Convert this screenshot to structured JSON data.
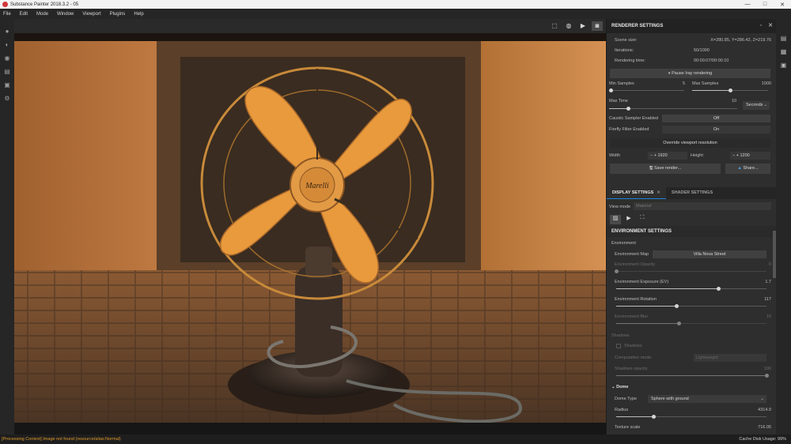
{
  "app": {
    "title": "Substance Painter 2018.3.2 - 05",
    "window_controls": [
      "—",
      "□",
      "✕"
    ]
  },
  "menu": [
    "File",
    "Edit",
    "Mode",
    "Window",
    "Viewport",
    "Plugins",
    "Help"
  ],
  "viewport": {
    "caption": "Marelli"
  },
  "renderer": {
    "title": "RENDERER SETTINGS",
    "scene_size_label": "Scene size:",
    "scene_size_value": "X=280.85, Y=286.42, Z=219.76",
    "iterations_label": "Iterations:",
    "iterations_value": "50/1000",
    "rendering_time_label": "Rendering time:",
    "rendering_time_value": "00:00:07/00:00:10",
    "pause_button": "Pause Iray rendering",
    "min_samples_label": "Min Samples",
    "min_samples_value": "5",
    "max_samples_label": "Max Samples",
    "max_samples_value": "1000",
    "max_time_label": "Max Time",
    "max_time_value": "10",
    "max_time_unit": "Seconds",
    "caustic_label": "Caustic Sampler Enabled",
    "caustic_value": "Off",
    "firefly_label": "Firefly Filter Enabled",
    "firefly_value": "On",
    "override_button": "Override viewport resolution",
    "width_label": "Width",
    "width_value": "1920",
    "height_label": "Height",
    "height_value": "1200",
    "save_render": "Save render...",
    "share": "Share..."
  },
  "tabs": [
    {
      "label": "DISPLAY SETTINGS",
      "active": true
    },
    {
      "label": "SHADER SETTINGS",
      "active": false
    }
  ],
  "display": {
    "view_mode_label": "View mode",
    "view_mode_placeholder": "Material",
    "env_settings_title": "ENVIRONMENT SETTINGS",
    "environment_label": "Environment",
    "env_map_label": "Environment Map",
    "env_map_value": "Villa Nova Street",
    "env_opacity_label": "Environment Opacity",
    "env_opacity_value": "0",
    "env_exposure_label": "Environment Exposure (EV)",
    "env_exposure_value": "1.7",
    "env_rotation_label": "Environment Rotation",
    "env_rotation_value": "117",
    "env_blur_label": "Environment Blur",
    "env_blur_value": "15",
    "shadows_section": "Shadows",
    "shadows_checkbox": "Shadows",
    "computation_label": "Computation mode",
    "computation_value": "Lightweight",
    "shadows_opacity_label": "Shadows opacity",
    "shadows_opacity_value": "100",
    "dome_section": "Dome",
    "dome_type_label": "Dome Type",
    "dome_type_value": "Sphere with ground",
    "radius_label": "Radius",
    "radius_value": "4314.9",
    "texture_scale_label": "Texture scale",
    "texture_scale_value": "716.05"
  },
  "sliders": {
    "min_samples": 0.03,
    "max_samples": 0.5,
    "max_time": 0.15,
    "env_opacity": 0.0,
    "env_exposure": 0.68,
    "env_rotation": 0.4,
    "env_blur": 0.42,
    "shadows_opacity": 1.0,
    "radius": 0.25
  },
  "status": {
    "message": "[Processing Context] Image not found (resource/alias:Normal)",
    "cache_label": "Cache Disk Usage:",
    "cache_value": "99%"
  },
  "colors": {
    "accent": "#1e80d8",
    "warning": "#e09a2b",
    "fan_orange": "#e89a3c"
  },
  "icons": {
    "left_toolbar": [
      "paint-icon",
      "eraser-icon",
      "projection-icon",
      "layers-icon",
      "bake-icon",
      "settings-icon"
    ],
    "viewport_toolbar": [
      "frame-icon",
      "sphere-icon",
      "camera-icon",
      "screenshot-icon"
    ]
  }
}
